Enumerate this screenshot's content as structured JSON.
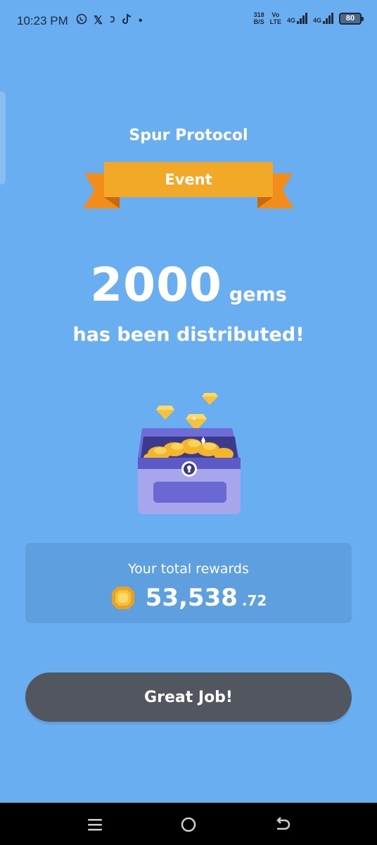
{
  "status_bar": {
    "time": "10:23 PM",
    "icons_left": [
      "whatsapp-icon",
      "x-icon",
      "app-icon",
      "tiktok-icon",
      "dot"
    ],
    "x_glyph": "𝕏",
    "dot_glyph": "•",
    "speed_value": "318",
    "speed_unit": "B/S",
    "volte_top": "Vo",
    "volte_bottom": "LTE",
    "net1": "4G",
    "net2": "4G",
    "battery": "80"
  },
  "brand": "Spur Protocol",
  "ribbon_label": "Event",
  "amount": {
    "value": "2000",
    "unit": "gems"
  },
  "distributed_text": "has been distributed!",
  "rewards": {
    "label": "Your total rewards",
    "value_main": "53,538",
    "value_decimal": ".72"
  },
  "button_label": "Great Job!",
  "colors": {
    "background": "#6AAEF2",
    "card": "#5E9FE0",
    "button": "#52565F",
    "ribbon": "#F2A928",
    "chest": "#A7A5EB"
  }
}
